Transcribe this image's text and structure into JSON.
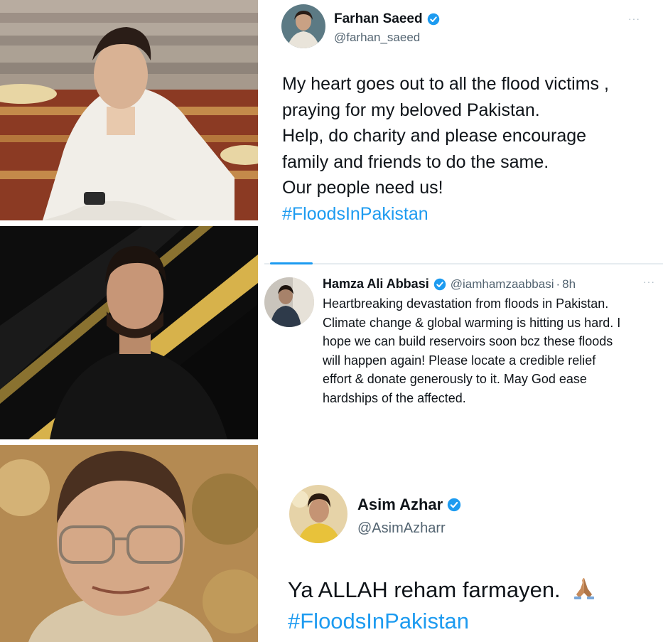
{
  "tweets": [
    {
      "display_name": "Farhan Saeed",
      "handle": "@farhan_saeed",
      "more": "···",
      "lines": [
        "My heart goes out to all the flood victims ,",
        "praying for my beloved Pakistan.",
        "Help, do charity and please encourage",
        "family and friends to do the same.",
        "Our people need us!"
      ],
      "hashtag": "#FloodsInPakistan",
      "verified_icon": "verified-badge-icon"
    },
    {
      "display_name": "Hamza Ali Abbasi",
      "handle": "@iamhamzaabbasi",
      "separator": "·",
      "time": "8h",
      "more": "···",
      "lines": [
        "Heartbreaking devastation from floods in Pakistan.",
        "Climate change & global warming is hitting us hard. I",
        "hope we can build reservoirs soon bcz these floods",
        "will happen again! Please locate a credible relief",
        "effort & donate generously to it. May God ease",
        "hardships of the affected."
      ],
      "verified_icon": "verified-badge-icon"
    },
    {
      "display_name": "Asim Azhar",
      "handle": "@AsimAzharr",
      "text": "Ya ALLAH reham farmayen.",
      "emoji_icon": "folded-hands-icon",
      "hashtag": "#FloodsInPakistan",
      "verified_icon": "verified-badge-icon"
    }
  ],
  "colors": {
    "verified": "#1d9bf0",
    "hashtag": "#1d9bf0",
    "handle": "#536471",
    "text": "#0f1419"
  }
}
